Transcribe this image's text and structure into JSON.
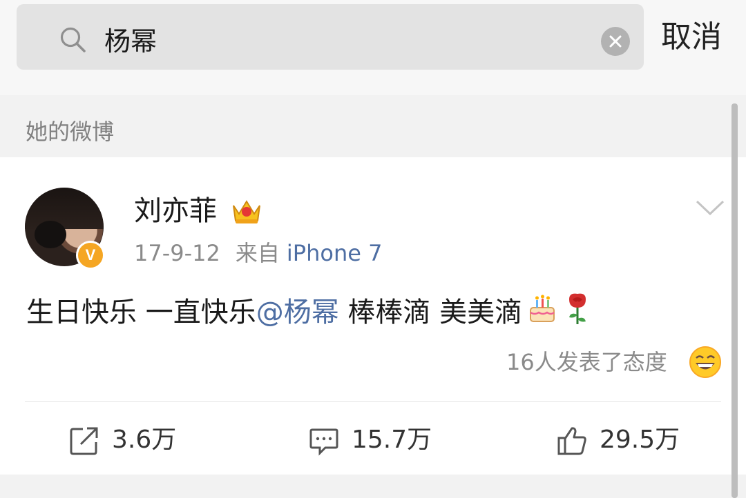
{
  "search": {
    "query": "杨幂",
    "cancel_label": "取消"
  },
  "section_label": "她的微博",
  "post": {
    "author": "刘亦菲",
    "verified_mark": "V",
    "date": "17-9-12",
    "source_prefix": "来自",
    "device": "iPhone 7",
    "text_before": "生日快乐 一直快乐",
    "mention": "@杨幂",
    "text_after": " 棒棒滴 美美滴",
    "reactions_text": "16人发表了态度"
  },
  "actions": {
    "reposts": "3.6万",
    "comments": "15.7万",
    "likes": "29.5万"
  },
  "icons": [
    "search-icon",
    "clear-icon",
    "crown-icon",
    "chevron-down-icon",
    "cake-icon",
    "rose-icon",
    "laugh-icon",
    "repost-icon",
    "comment-icon",
    "like-icon"
  ],
  "colors": {
    "link": "#4e6ea3",
    "badge": "#f5a623"
  }
}
